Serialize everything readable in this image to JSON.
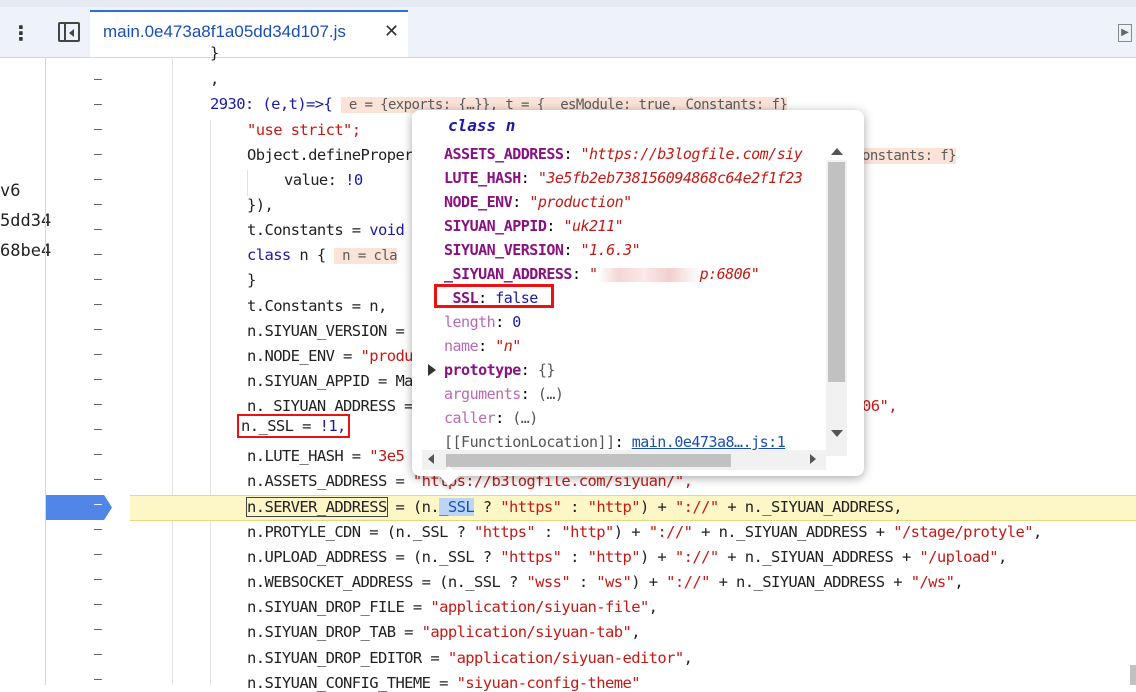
{
  "tab": {
    "label": "main.0e473a8f1a05dd34d107.js",
    "close": "✕"
  },
  "toolbar": {
    "menu": "⋮",
    "right_toggle": "▶"
  },
  "left_panel_fragments": [
    "v6",
    "5dd34",
    "68be4"
  ],
  "gutter_marks": [
    "–",
    "–",
    "–",
    "–",
    "–",
    "–",
    "–",
    "–",
    "–",
    "–",
    "–",
    "–",
    "–",
    "–",
    "–",
    "–",
    "–",
    "–",
    "–",
    "–",
    "–",
    "–",
    "–",
    "–",
    "–"
  ],
  "code": {
    "l1": "}",
    "l2": ",",
    "l3_a": "2930: (e,t)=>{",
    "l3_inline": " e = {exports: {…}}, t = {__esModule: true, Constants: f}",
    "l4": "\"use strict\";",
    "l5": "Object.definePropert",
    "l5_inline": "onstants: f}",
    "l6_a": "value: ",
    "l6_b": "!0",
    "l7": "}),",
    "l8_a": "t.Constants = ",
    "l8_b": "void",
    "l9_a": "class",
    "l9_b": " n {",
    "l9_inline": " n = cla",
    "l10": "}",
    "l11": "t.Constants = n,",
    "l12": "n.SIYUAN_VERSION =",
    "l13_a": "n.NODE_ENV = ",
    "l13_b": "\"produ",
    "l14": "n.SIYUAN_APPID = Ma",
    "l15": "n._SIYUAN_ADDRESS =",
    "l15_tail": "06\",",
    "l16_a": "n._SSL = ",
    "l16_b": "!1,",
    "l17_a": "n.LUTE_HASH = ",
    "l17_b": "\"3e5",
    "l18_a": "n.ASSETS_ADDRESS = ",
    "l18_b": "\"https://b3logfile.com/siyuan/\",",
    "l19_a": "n.SERVER_ADDRESS",
    "l19_b": " = (n.",
    "l19_c": "_SSL",
    "l19_d": " ? ",
    "l19_e": "\"https\"",
    "l19_f": " : ",
    "l19_g": "\"http\"",
    "l19_h": ") + ",
    "l19_i": "\"://\"",
    "l19_j": " + n._SIYUAN_ADDRESS,",
    "l20_a": "n.PROTYLE_CDN = (n._SSL ? ",
    "l20_b": "\"https\"",
    "l20_c": " : ",
    "l20_d": "\"http\"",
    "l20_e": ") + ",
    "l20_f": "\"://\"",
    "l20_g": " + n._SIYUAN_ADDRESS + ",
    "l20_h": "\"/stage/protyle\"",
    "l20_i": ",",
    "l21_a": "n.UPLOAD_ADDRESS = (n._SSL ? ",
    "l21_b": "\"https\"",
    "l21_c": " : ",
    "l21_d": "\"http\"",
    "l21_e": ") + ",
    "l21_f": "\"://\"",
    "l21_g": " + n._SIYUAN_ADDRESS + ",
    "l21_h": "\"/upload\"",
    "l21_i": ",",
    "l22_a": "n.WEBSOCKET_ADDRESS = (n._SSL ? ",
    "l22_b": "\"wss\"",
    "l22_c": " : ",
    "l22_d": "\"ws\"",
    "l22_e": ") + ",
    "l22_f": "\"://\"",
    "l22_g": " + n._SIYUAN_ADDRESS + ",
    "l22_h": "\"/ws\"",
    "l22_i": ",",
    "l23_a": "n.SIYUAN_DROP_FILE = ",
    "l23_b": "\"application/siyuan-file\"",
    "l23_c": ",",
    "l24_a": "n.SIYUAN_DROP_TAB = ",
    "l24_b": "\"application/siyuan-tab\"",
    "l24_c": ",",
    "l25_a": "n.SIYUAN_DROP_EDITOR = ",
    "l25_b": "\"application/siyuan-editor\"",
    "l25_c": ",",
    "l26_a": "n.SIYUAN_CONFIG_THEME = ",
    "l26_b": "\"siyuan-config-theme\""
  },
  "popup": {
    "title": "class n",
    "rows": [
      {
        "key": "ASSETS_ADDRESS",
        "value": "\"https://b3logfile.com/siy"
      },
      {
        "key": "LUTE_HASH",
        "value": "\"3e5fb2eb738156094868c64e2f1f23"
      },
      {
        "key": "NODE_ENV",
        "value": "\"production\""
      },
      {
        "key": "SIYUAN_APPID",
        "value": "\"uk211\""
      },
      {
        "key": "SIYUAN_VERSION",
        "value": "\"1.6.3\""
      },
      {
        "key": "_SIYUAN_ADDRESS",
        "value_start": "\"",
        "value_end": "p:6806\""
      },
      {
        "key": "_SSL",
        "value": "false"
      },
      {
        "key": "length",
        "value": "0"
      },
      {
        "key": "name",
        "value": "\"n\""
      },
      {
        "key": "prototype",
        "value": "{}"
      },
      {
        "key": "arguments",
        "value": "(…)"
      },
      {
        "key": "caller",
        "value": "(…)"
      },
      {
        "key": "[[FunctionLocation]]",
        "value": "main.0e473a8…",
        "suffix": ".js:1"
      }
    ]
  },
  "colors": {
    "accent": "#2f6fd6",
    "breakpoint": "#4f86e8",
    "highlight": "#fdf6c6",
    "annotation": "#e11111"
  }
}
